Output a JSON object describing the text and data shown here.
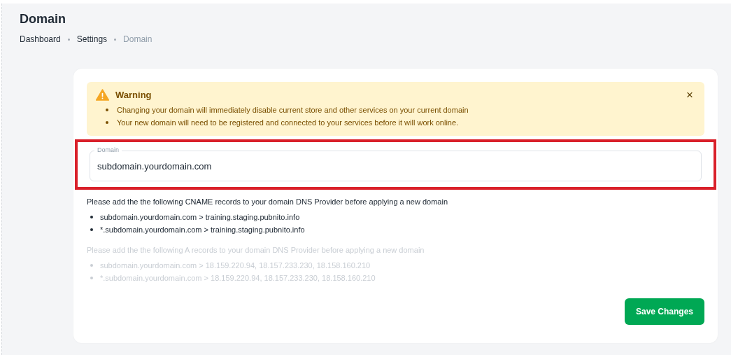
{
  "page": {
    "title": "Domain"
  },
  "breadcrumbs": [
    {
      "label": "Dashboard",
      "current": false
    },
    {
      "label": "Settings",
      "current": false
    },
    {
      "label": "Domain",
      "current": true
    }
  ],
  "warning": {
    "title": "Warning",
    "close": "×",
    "items": [
      "Changing your domain will immediately disable current store and other services on your current domain",
      "Your new domain will need to be registered and connected to your services before it will work online."
    ]
  },
  "domain_field": {
    "label": "Domain",
    "value": "subdomain.yourdomain.com",
    "highlighted": true
  },
  "record_sections": [
    {
      "intro": "Please add the the following CNAME records to your domain DNS Provider before applying a new domain",
      "disabled": false,
      "items": [
        "subdomain.yourdomain.com > training.staging.pubnito.info",
        "*.subdomain.yourdomain.com > training.staging.pubnito.info"
      ]
    },
    {
      "intro": "Please add the the following A records to your domain DNS Provider before applying a new domain",
      "disabled": true,
      "items": [
        "subdomain.yourdomain.com > 18.159.220.94, 18.157.233.230, 18.158.160.210",
        "*.subdomain.yourdomain.com > 18.159.220.94, 18.157.233.230, 18.158.160.210"
      ]
    }
  ],
  "save_button": "Save Changes"
}
